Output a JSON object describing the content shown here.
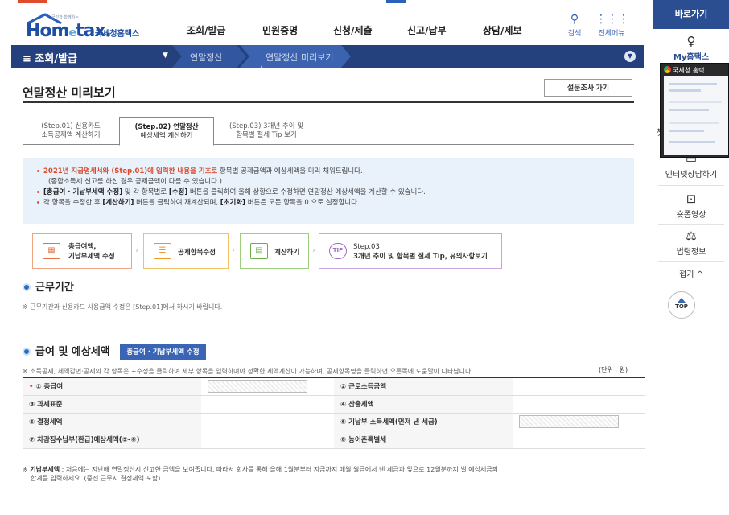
{
  "header": {
    "logo_tagline": "국민과 함께하는",
    "logo_main": "Hom",
    "logo_e": "e",
    "logo_rest": "tax.",
    "logo_kor": "국세청홈택스",
    "menus": [
      "조회/발급",
      "민원증명",
      "신청/제출",
      "신고/납부",
      "상담/제보"
    ],
    "search_label": "검색",
    "allmenu_label": "전체메뉴"
  },
  "navbar": {
    "menu_label": "≡  조회/발급",
    "crumb1": "연말정산",
    "crumb2": "연말정산 미리보기 ★"
  },
  "page": {
    "title": "연말정산 미리보기",
    "survey_button": "설문조사 가기"
  },
  "steps": [
    {
      "line1": "(Step.01) 신용카드",
      "line2": "소득공제액 계산하기"
    },
    {
      "line1": "(Step.02) 연말정산",
      "line2": "예상세액 계산하기"
    },
    {
      "line1": "(Step.03) 3개년 추이 및",
      "line2": "항목별 절세 Tip 보기"
    }
  ],
  "notice": {
    "l1_red": "2021년 지급명세서와 (Step.01)에 입력한 내용을 기초로",
    "l1_rest": " 항목별 공제금액과 예상세액을 미리 채워드립니다.",
    "l2": "(종합소득세 신고를 하신 경우 공제금액이 다를 수 있습니다.)",
    "l3_b": "[총급여 · 기납부세액 수정]",
    "l3_m": " 및 각 항목별로 ",
    "l3_b2": "[수정]",
    "l3_rest": " 버튼을 클릭하여 올해 상황으로 수정하면 연말정산 예상세액을 계산할 수 있습니다.",
    "l4_a": "각 항목을 수정한 후 ",
    "l4_b": "[계산하기]",
    "l4_c": " 버튼을 클릭하여 재계산되며, ",
    "l4_d": "[초기화]",
    "l4_e": " 버튼은 모든 항목을 0 으로 설정합니다."
  },
  "flow": {
    "b1_line1": "총급여액,",
    "b1_line2": "기납부세액 수정",
    "b2": "공제항목수정",
    "b3": "계산하기",
    "b4_line1": "Step.03",
    "b4_line2": "3개년 추이 및 항목별 절세 Tip, 유의사항보기",
    "tip_icon": "TIP"
  },
  "work": {
    "title": "근무기간",
    "note": "※ 근무기간과 신용카드 사용금액 수정은 [Step.01]에서 하시기 바랍니다."
  },
  "salary": {
    "title": "급여 및 예상세액",
    "edit_button": "총급여 · 기납부세액 수정",
    "note": "※ 소득공제, 세액감면·공제의 각 항목은 +수정을 클릭하여 세부 항목을 입력하여야 정확한 세액계산이 가능하며, 공제항목명을 클릭하면 오른쪽에 도움말이 나타납니다.",
    "unit": "(단위 : 원)",
    "rows": [
      {
        "left": "① 총급여",
        "right": "② 근로소득금액"
      },
      {
        "left": "③ 과세표준",
        "right": "④ 산출세액"
      },
      {
        "left": "⑤ 결정세액",
        "right": "⑥ 기납부 소득세액(먼저 낸 세금)"
      },
      {
        "left": "⑦ 차감징수납부(환급)예상세액(⑤-⑥)",
        "right": "⑧ 농어촌특별세"
      }
    ],
    "required_mark": "•"
  },
  "footnote": {
    "bold": "기납부세액",
    "line1": " : 처음에는 지난해 연말정산시 신고한 금액을 보여줍니다. 따라서 회사를 통해 올해 1월분부터 지금까지 매월 월급에서 낸 세금과 앞으로 12월분까지 낼 예상세금의",
    "line2": "합계를 입력하세요. (중전 근무지 결정세액 포함)",
    "prefix": "※ "
  },
  "quick": {
    "title": "바로가기",
    "my": "My홈택스",
    "ch": "챗",
    "consult": "인터넷상담하기",
    "video": "숏폼영상",
    "law": "법령정보",
    "fold": "접기 ^",
    "top": "TOP"
  },
  "popup": {
    "title": "국세청 홈택"
  }
}
